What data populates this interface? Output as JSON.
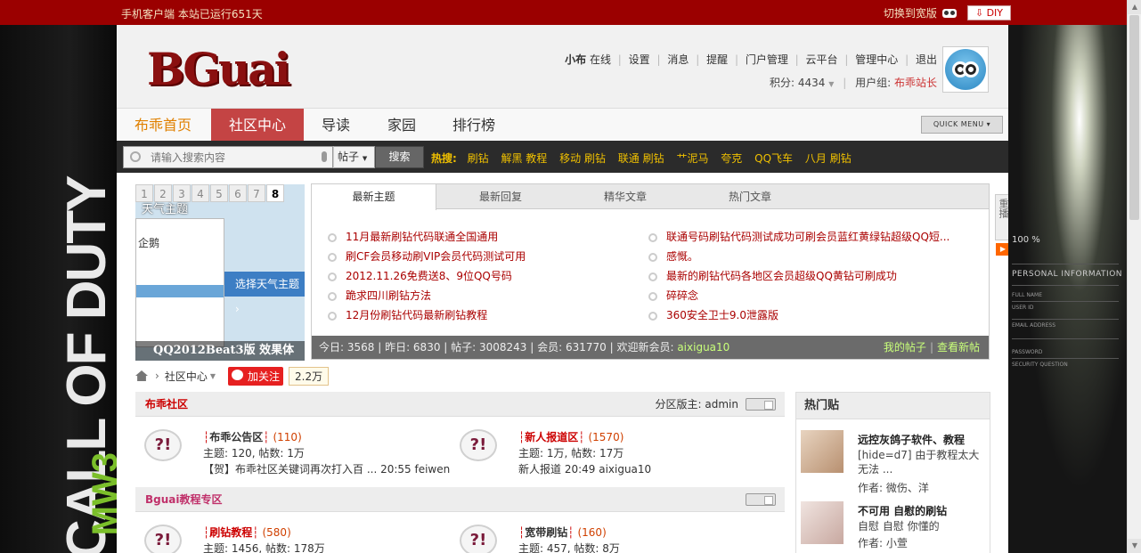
{
  "topbar": {
    "client": "手机客户端",
    "running": "本站已运行651天",
    "wide": "切换到宽版",
    "diy": "DIY"
  },
  "header": {
    "logo": "BGuai",
    "user": "小布",
    "online": "在线",
    "links": [
      "设置",
      "消息",
      "提醒",
      "门户管理",
      "云平台",
      "管理中心",
      "退出"
    ],
    "credits_label": "积分: 4434",
    "group_label": "用户组:",
    "group": "布乖站长"
  },
  "nav": {
    "items": [
      "布乖首页",
      "社区中心",
      "导读",
      "家园",
      "排行榜"
    ],
    "quick_menu": "QUICK MENU"
  },
  "search": {
    "placeholder": "请输入搜索内容",
    "type": "帖子",
    "button": "搜索",
    "hot_label": "热搜:",
    "hot": [
      "刷钻",
      "解黑 教程",
      "移动 刷钻",
      "联通 刷钻",
      "艹泥马",
      "夸克",
      "QQ飞车",
      "八月 刷钻"
    ]
  },
  "slide": {
    "pages": [
      "1",
      "2",
      "3",
      "4",
      "5",
      "6",
      "7",
      "8"
    ],
    "theme_title": "天气主题",
    "qq_label": "企鹅",
    "select_theme": "选择天气主题",
    "caption": "QQ2012Beat3版 效果体"
  },
  "tabs": {
    "labels": [
      "最新主题",
      "最新回复",
      "精华文章",
      "热门文章"
    ],
    "left": [
      "11月最新刷钻代码联通全国通用",
      "刷CF会员移动刷VIP会员代码测试可用",
      "2012.11.26免费送8、9位QQ号码",
      "跪求四川刷钻方法",
      "12月份刷钻代码最新刷钻教程"
    ],
    "right": [
      "联通号码刷钻代码测试成功可刷会员蓝红黄绿钻超级QQ短...",
      "感慨。",
      "最新的刷钻代码各地区会员超级QQ黄钻可刷成功",
      "碎碎念",
      "360安全卫士9.0泄露版"
    ],
    "stats": "今日: 3568 | 昨日: 6830 | 帖子: 3008243 | 会员: 631770 | 欢迎新会员:",
    "new_member": "aixigua10",
    "my_posts": "我的帖子",
    "view_new": "查看新帖"
  },
  "replay": {
    "label": "重播"
  },
  "crumb": {
    "center": "社区中心",
    "follow": "加关注",
    "count": "2.2万"
  },
  "sections": [
    {
      "title": "布乖社区",
      "moderator": "分区版主: admin",
      "forums": [
        {
          "name": "布乖公告区",
          "count": "(110)",
          "stat": "主题: 120, 帖数: 1万",
          "last": "【贺】布乖社区关键词再次打入百 ... 20:55 feiwen"
        },
        {
          "name": "新人报道区",
          "count": "(1570)",
          "stat": "主题: 1万, 帖数: 17万",
          "last": "新人报道 20:49 aixigua10"
        }
      ]
    },
    {
      "title": "Bguai教程专区",
      "moderator": "",
      "forums": [
        {
          "name": "刷钻教程",
          "count": "(580)",
          "stat": "主题: 1456, 帖数: 178万",
          "last": ""
        },
        {
          "name": "宽带刷钻",
          "count": "(160)",
          "stat": "主题: 457, 帖数: 8万",
          "last": ""
        }
      ]
    }
  ],
  "hot": {
    "title": "热门贴",
    "posts": [
      {
        "title": "远控灰鸽子软件、教程",
        "desc": "[hide=d7] 由于教程太大无法 ...",
        "author": "作者: 微伤、洋"
      },
      {
        "title": "不可用 自慰的刷钻",
        "desc": "自慰 自慰 你懂的",
        "author": "作者: 小萱"
      }
    ]
  },
  "right_bg": {
    "percent": "100 %",
    "personal": "PERSONAL INFORMATION",
    "fields": [
      "FULL NAME",
      "USER ID",
      "EMAIL ADDRESS",
      "PASSWORD",
      "SECURITY QUESTION"
    ]
  }
}
